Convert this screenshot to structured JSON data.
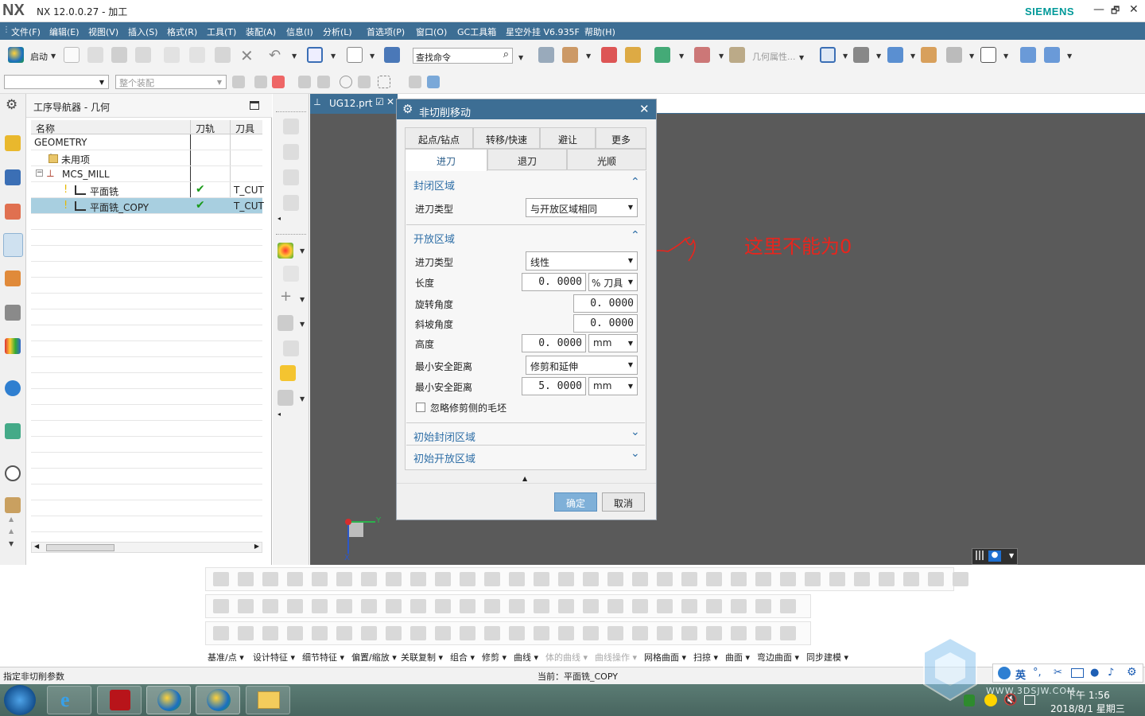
{
  "titlebar": {
    "logo": "NX",
    "title": "NX 12.0.0.27 - 加工",
    "brand": "SIEMENS",
    "min": "—",
    "restore": "🗗",
    "close": "✕"
  },
  "menu": [
    "文件(F)",
    "编辑(E)",
    "视图(V)",
    "插入(S)",
    "格式(R)",
    "工具(T)",
    "装配(A)",
    "信息(I)",
    "分析(L)",
    "首选项(P)",
    "窗口(O)",
    "GC工具箱",
    "星空外挂 V6.935F",
    "帮助(H)"
  ],
  "toolbar": {
    "start_label": "启动",
    "search_placeholder": "查找命令",
    "geometry_props": "几何属性..."
  },
  "filters": {
    "selection": "",
    "scope": "整个装配"
  },
  "navigator": {
    "title": "工序导航器 - 几何",
    "columns": [
      "名称",
      "刀轨",
      "刀具"
    ],
    "rows": [
      {
        "name": "GEOMETRY",
        "path": "",
        "tool": ""
      },
      {
        "name": "未用项",
        "path": "",
        "tool": ""
      },
      {
        "name": "MCS_MILL",
        "path": "",
        "tool": ""
      },
      {
        "name": "平面铣",
        "path": "✔",
        "tool": "T_CUT"
      },
      {
        "name": "平面铣_COPY",
        "path": "✔",
        "tool": "T_CUT"
      }
    ]
  },
  "doc_tab": {
    "label": "UG12.prt"
  },
  "dialog": {
    "title": "非切削移动",
    "close": "✕",
    "tabs_row1": [
      "起点/钻点",
      "转移/快速",
      "避让",
      "更多"
    ],
    "tabs_row2": [
      "进刀",
      "退刀",
      "光顺"
    ],
    "closed_region": {
      "title": "封闭区域",
      "engage_type_label": "进刀类型",
      "engage_type_value": "与开放区域相同"
    },
    "open_region": {
      "title": "开放区域",
      "engage_type_label": "进刀类型",
      "engage_type_value": "线性",
      "length_label": "长度",
      "length_value": "0. 0000",
      "length_unit": "% 刀具",
      "rotation_label": "旋转角度",
      "rotation_value": "0. 0000",
      "ramp_label": "斜坡角度",
      "ramp_value": "0. 0000",
      "height_label": "高度",
      "height_value": "0. 0000",
      "height_unit": "mm",
      "min_clear_label": "最小安全距离",
      "min_clear_type": "修剪和延伸",
      "min_clear_dist_label": "最小安全距离",
      "min_clear_dist_value": "5. 0000",
      "min_clear_dist_unit": "mm",
      "ignore_label": "忽略修剪侧的毛坯"
    },
    "initial_closed": "初始封闭区域",
    "initial_open": "初始开放区域",
    "ok": "确定",
    "cancel": "取消"
  },
  "annotation": {
    "text": "这里不能为0",
    "color": "#e8251d"
  },
  "axes": {
    "y": "Y",
    "x": "X"
  },
  "bottom_menu": [
    "基准/点 ▾",
    "设计特征 ▾",
    "细节特征 ▾",
    "偏置/缩放 ▾",
    "关联复制 ▾",
    "组合 ▾",
    "修剪 ▾",
    "曲线 ▾",
    "体的曲线 ▾",
    "曲线操作 ▾",
    "网格曲面 ▾",
    "扫掠 ▾",
    "曲面 ▾",
    "弯边曲面 ▾",
    "同步建模 ▾"
  ],
  "status": {
    "left": "指定非切削参数",
    "center": "当前：平面铣_COPY"
  },
  "taskbar": {
    "time": "下午 1:56",
    "date": "2018/8/1 星期三",
    "ime": "英",
    "watermark": "WWW.3DSJW.COM"
  }
}
